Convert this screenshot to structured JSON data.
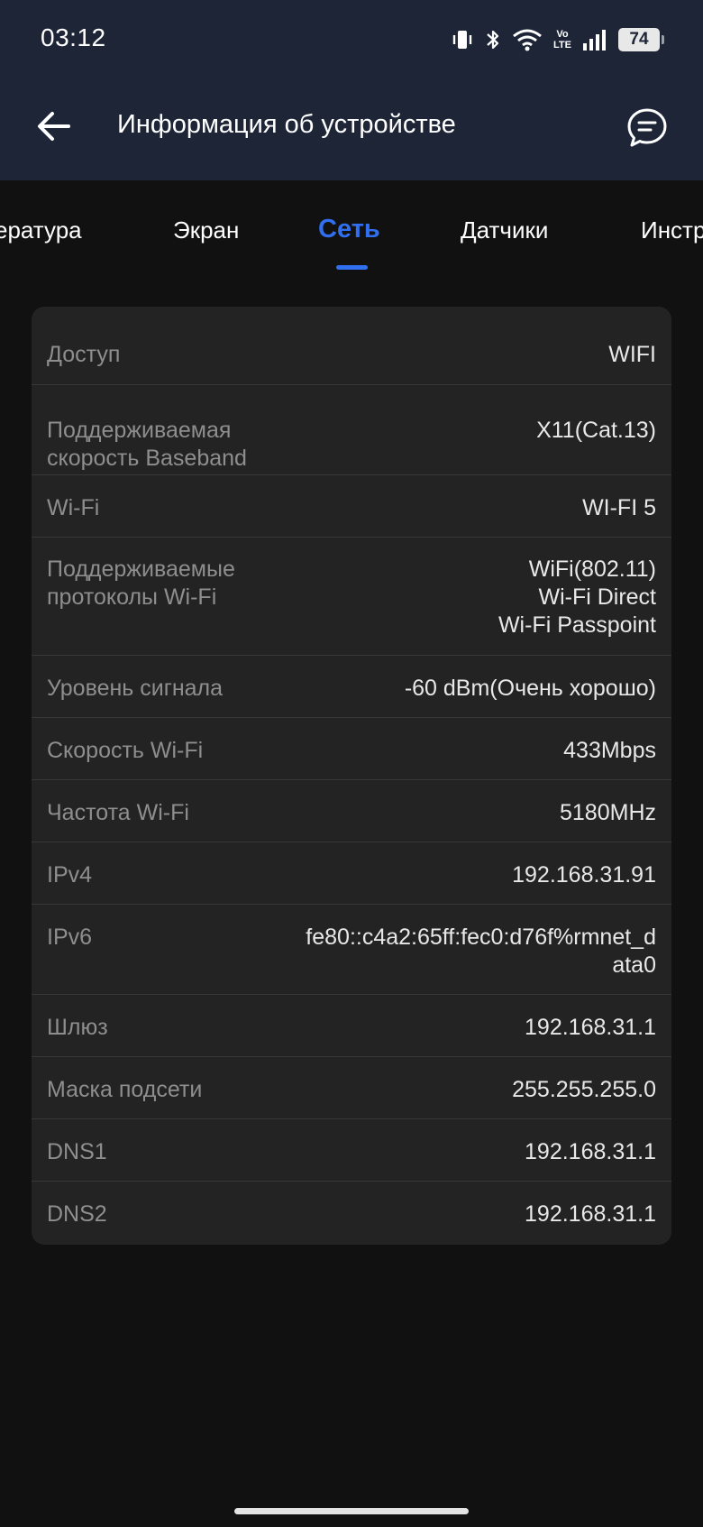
{
  "status_bar": {
    "time": "03:12",
    "volte_top": "Vo",
    "volte_bottom": "LTE",
    "battery": "74"
  },
  "header": {
    "title": "Информация об устройстве"
  },
  "tabs": [
    {
      "label": "ература"
    },
    {
      "label": "Экран"
    },
    {
      "label": "Сеть"
    },
    {
      "label": "Датчики"
    },
    {
      "label": "Инстр"
    }
  ],
  "active_tab": "Сеть",
  "colors": {
    "accent": "#2f6ff0",
    "header_bg": "#1d2537",
    "card_bg": "#232323"
  },
  "network": {
    "rows": [
      {
        "label": "Доступ",
        "value": "WIFI"
      },
      {
        "label": "Поддерживаемая скорость Baseband",
        "value": "X11(Cat.13)"
      },
      {
        "label": "Wi-Fi",
        "value": "WI-FI 5"
      },
      {
        "label": "Поддерживаемые протоколы Wi-Fi",
        "value_lines": [
          "WiFi(802.11)",
          "Wi-Fi Direct",
          "Wi-Fi Passpoint"
        ]
      },
      {
        "label": "Уровень сигнала",
        "value": "-60 dBm(Очень хорошо)"
      },
      {
        "label": "Скорость Wi-Fi",
        "value": "433Mbps"
      },
      {
        "label": "Частота Wi-Fi",
        "value": "5180MHz"
      },
      {
        "label": "IPv4",
        "value": "192.168.31.91"
      },
      {
        "label": "IPv6",
        "value": "fe80::c4a2:65ff:fec0:d76f%rmnet_data0"
      },
      {
        "label": "Шлюз",
        "value": "192.168.31.1"
      },
      {
        "label": "Маска подсети",
        "value": "255.255.255.0"
      },
      {
        "label": "DNS1",
        "value": "192.168.31.1"
      },
      {
        "label": "DNS2",
        "value": "192.168.31.1"
      }
    ]
  }
}
